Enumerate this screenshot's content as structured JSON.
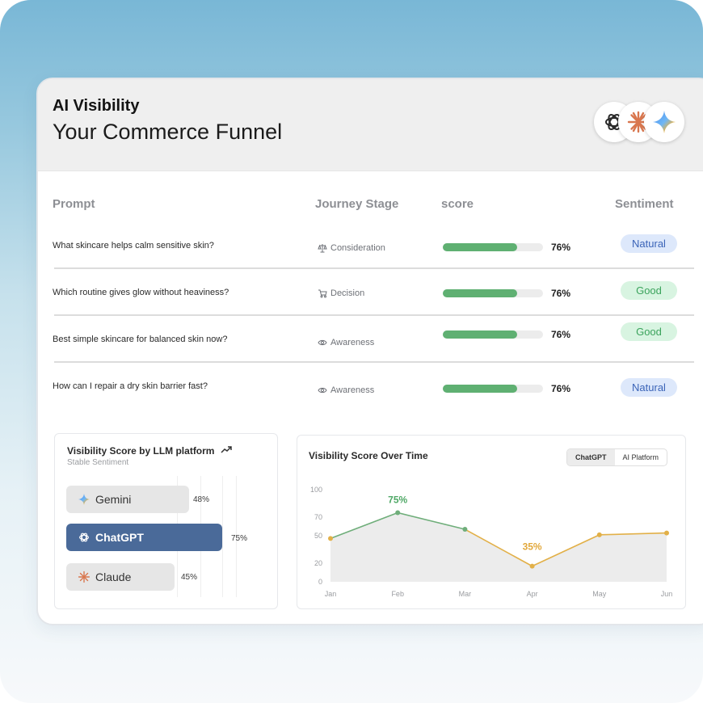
{
  "header": {
    "app_title": "AI Visibility",
    "page_title": "Your Commerce Funnel",
    "logos": [
      "chatgpt-logo",
      "claude-logo",
      "gemini-logo"
    ]
  },
  "table": {
    "columns": [
      "Prompt",
      "Journey Stage",
      "score",
      "Sentiment"
    ],
    "rows": [
      {
        "prompt": "What skincare helps calm sensitive skin?",
        "stage": "Consideration",
        "stage_icon": "scale-icon",
        "score": 76,
        "score_label": "76%",
        "sentiment": "Natural"
      },
      {
        "prompt": "Which routine gives glow without heaviness?",
        "stage": "Decision",
        "stage_icon": "cart-icon",
        "score": 76,
        "score_label": "76%",
        "sentiment": "Good"
      },
      {
        "prompt": "Best simple skincare for balanced skin now?",
        "stage": "Awareness",
        "stage_icon": "eye-icon",
        "score": 76,
        "score_label": "76%",
        "sentiment": "Good"
      },
      {
        "prompt": "How can I repair a dry skin barrier fast?",
        "stage": "Awareness",
        "stage_icon": "eye-icon",
        "score": 76,
        "score_label": "76%",
        "sentiment": "Natural"
      }
    ]
  },
  "llm_panel": {
    "title": "Visibility Score by LLM platform",
    "subtitle": "Stable Sentiment",
    "bars": [
      {
        "name": "Gemini",
        "value": 48,
        "label": "48%",
        "color": "#e6e6e6",
        "text_color": "#333333"
      },
      {
        "name": "ChatGPT",
        "value": 75,
        "label": "75%",
        "color": "#4a6a99",
        "text_color": "#ffffff"
      },
      {
        "name": "Claude",
        "value": 45,
        "label": "45%",
        "color": "#e6e6e6",
        "text_color": "#333333"
      }
    ]
  },
  "time_panel": {
    "title": "Visibility Score Over Time",
    "toggle": [
      "ChatGPT",
      "AI Platform"
    ],
    "active_toggle": "ChatGPT"
  },
  "chart_data": {
    "type": "line",
    "title": "Visibility Score Over Time",
    "categories": [
      "Jan",
      "Feb",
      "Mar",
      "Apr",
      "May",
      "Jun"
    ],
    "values": [
      47,
      75,
      57,
      17,
      51,
      53
    ],
    "yticks": [
      0,
      20,
      50,
      70,
      100
    ],
    "annotations": [
      {
        "x": "Feb",
        "label": "75%",
        "color": "#4fa866"
      },
      {
        "x": "Apr",
        "label": "35%",
        "color": "#e2a83b"
      }
    ],
    "colors": {
      "rise": "#6fae7a",
      "fall": "#e2b048"
    },
    "grid": false
  }
}
